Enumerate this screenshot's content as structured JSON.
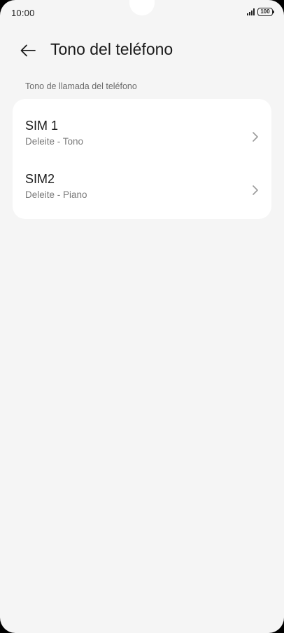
{
  "status_bar": {
    "time": "10:00",
    "battery": "100",
    "icons": [
      "signal-icon",
      "battery-icon"
    ]
  },
  "header": {
    "back_icon": "arrow-left-icon",
    "title": "Tono del teléfono"
  },
  "section": {
    "label": "Tono de llamada del teléfono"
  },
  "items": [
    {
      "title": "SIM 1",
      "subtitle": "Deleite - Tono",
      "icon": "chevron-right-icon"
    },
    {
      "title": "SIM2",
      "subtitle": "Deleite - Piano",
      "icon": "chevron-right-icon"
    }
  ],
  "colors": {
    "background": "#f5f5f5",
    "card": "#ffffff",
    "text_primary": "#1a1a1a",
    "text_secondary": "#7a7a7a"
  }
}
